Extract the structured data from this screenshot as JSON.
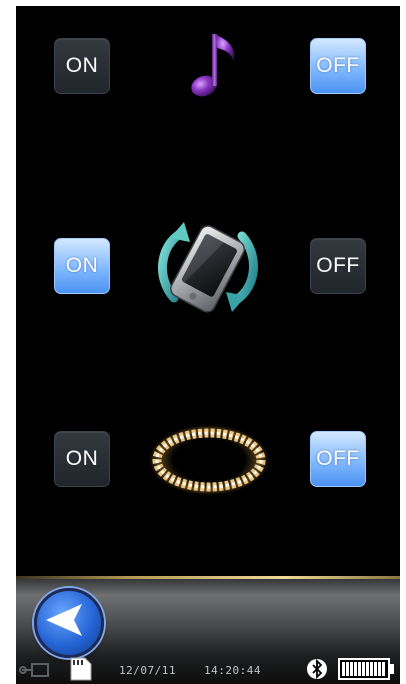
{
  "rows": [
    {
      "on_label": "ON",
      "off_label": "OFF",
      "active": "off",
      "icon": "music-note-icon"
    },
    {
      "on_label": "ON",
      "off_label": "OFF",
      "active": "on",
      "icon": "rotate-device-icon"
    },
    {
      "on_label": "ON",
      "off_label": "OFF",
      "active": "off",
      "icon": "led-ring-icon"
    }
  ],
  "status_bar": {
    "date": "12/07/11",
    "time": "14:20:44",
    "icons": [
      "usb-connection-icon",
      "sd-card-icon",
      "bluetooth-icon",
      "battery-icon"
    ],
    "battery_level": 1.0
  },
  "navigation": {
    "back_icon": "back-arrow-icon"
  },
  "colors": {
    "active_button": "#8fc1ff",
    "inactive_button": "#2a2f35",
    "background": "#000000",
    "accent_gold": "#f2d99a",
    "music_note": "#7b2fa8"
  }
}
